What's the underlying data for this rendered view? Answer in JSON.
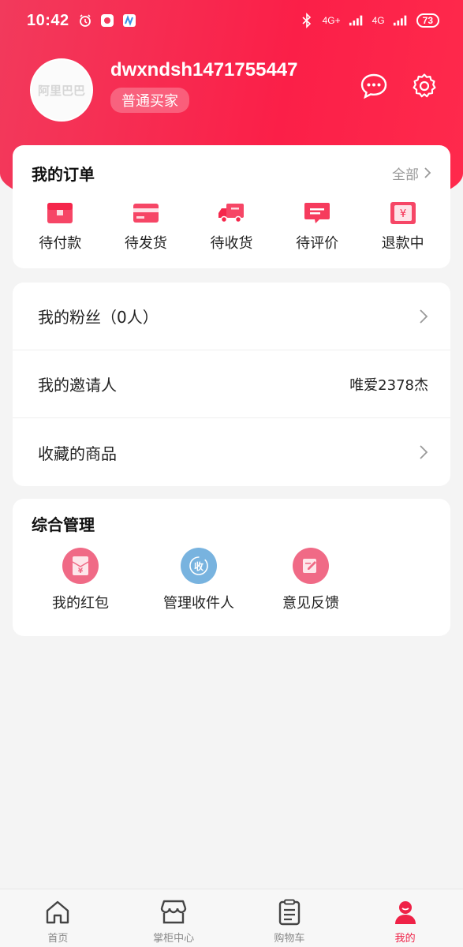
{
  "colors": {
    "brand": "#f5264b",
    "muted": "#999999"
  },
  "status_bar": {
    "time": "10:42",
    "net1": "4G+",
    "net2": "4G",
    "battery": "73",
    "icons": [
      "alarm-icon",
      "app-notification-icon",
      "app-notification-icon",
      "bluetooth-icon",
      "signal-icon"
    ]
  },
  "profile": {
    "avatar_text": "阿里巴巴",
    "username": "dwxndsh1471755447",
    "level": "普通买家",
    "actions": [
      "message-icon",
      "settings-icon"
    ]
  },
  "orders": {
    "title": "我的订单",
    "more": "全部",
    "items": [
      {
        "label": "待付款",
        "icon": "wallet-icon"
      },
      {
        "label": "待发货",
        "icon": "card-icon"
      },
      {
        "label": "待收货",
        "icon": "truck-icon"
      },
      {
        "label": "待评价",
        "icon": "comment-icon"
      },
      {
        "label": "退款中",
        "icon": "refund-icon"
      }
    ]
  },
  "list": [
    {
      "label": "我的粉丝（0人）",
      "value": "",
      "arrow": true
    },
    {
      "label": "我的邀请人",
      "value": "唯爱2378杰",
      "arrow": false
    },
    {
      "label": "收藏的商品",
      "value": "",
      "arrow": true
    }
  ],
  "manage": {
    "title": "综合管理",
    "items": [
      {
        "label": "我的红包",
        "icon": "red-packet-icon",
        "glyph": "¥",
        "color": "#f06a86"
      },
      {
        "label": "管理收件人",
        "icon": "receiver-icon",
        "glyph": "收",
        "color": "#78b3df"
      },
      {
        "label": "意见反馈",
        "icon": "feedback-icon",
        "glyph": "✎",
        "color": "#f06a86"
      }
    ]
  },
  "tabs": [
    {
      "label": "首页",
      "icon": "home-icon",
      "active": false
    },
    {
      "label": "掌柜中心",
      "icon": "store-icon",
      "active": false
    },
    {
      "label": "购物车",
      "icon": "cart-list-icon",
      "active": false
    },
    {
      "label": "我的",
      "icon": "profile-icon",
      "active": true
    }
  ]
}
